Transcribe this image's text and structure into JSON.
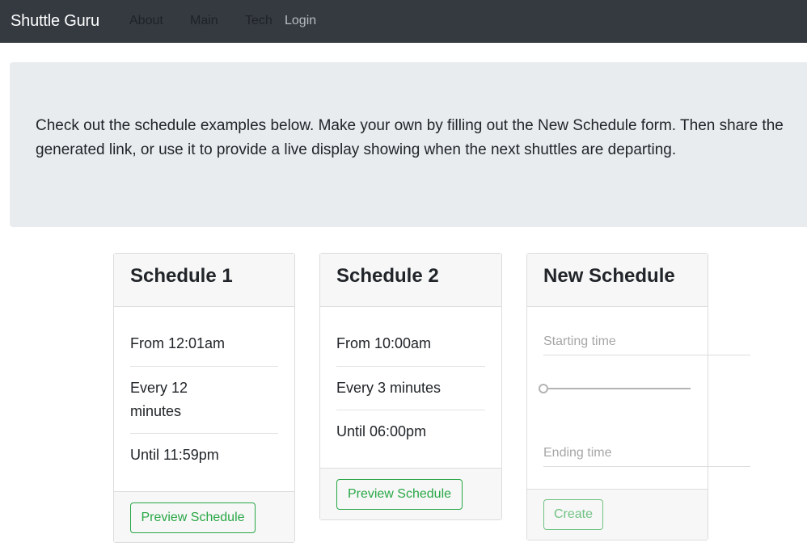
{
  "navbar": {
    "brand": "Shuttle Guru",
    "links": [
      "About",
      "Main",
      "Tech",
      "Login"
    ]
  },
  "jumbotron": {
    "text": "Check out the schedule examples below. Make your own by filling out the New Schedule form. Then share the generated link, or use it to provide a live display showing when the next shuttles are departing."
  },
  "cards": [
    {
      "title": "Schedule 1",
      "items": [
        "From 12:01am",
        "Every 12 minutes",
        "Until 11:59pm"
      ],
      "button": "Preview Schedule"
    },
    {
      "title": "Schedule 2",
      "items": [
        "From 10:00am",
        "Every 3 minutes",
        "Until 06:00pm"
      ],
      "button": "Preview Schedule"
    }
  ],
  "new_schedule": {
    "title": "New Schedule",
    "starting_placeholder": "Starting time",
    "ending_placeholder": "Ending time",
    "slider_value": 0,
    "button": "Create"
  },
  "colors": {
    "navbar": "#343a40",
    "jumbotron": "#e9ecef",
    "success": "#28a745"
  }
}
